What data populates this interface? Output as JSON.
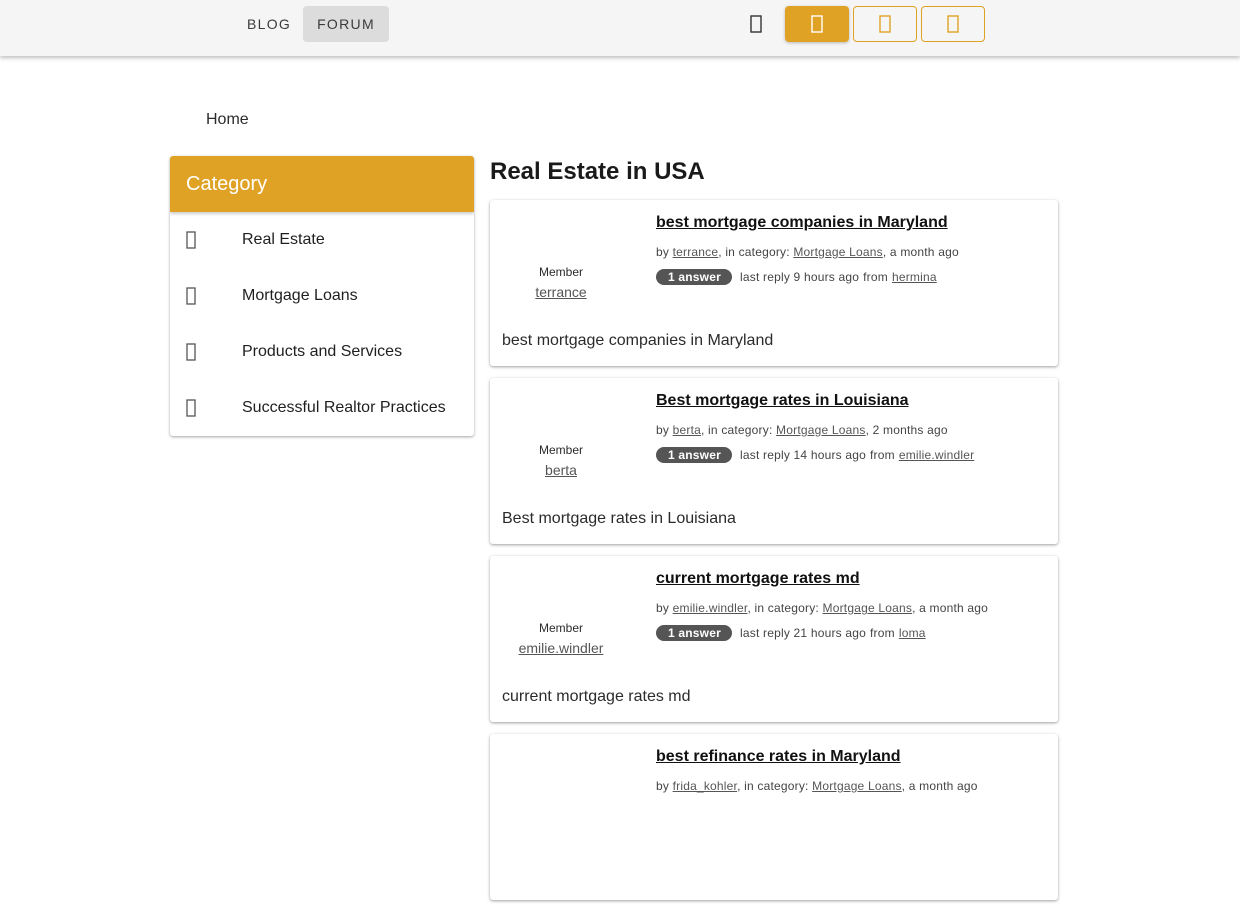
{
  "nav": {
    "blog_label": "BLOG",
    "forum_label": "FORUM",
    "icons": [
      "search-icon",
      "primary-action-icon",
      "outline-action-icon",
      "outline-action-icon"
    ],
    "accent_color": "#e0a224"
  },
  "breadcrumb": {
    "home_label": "Home"
  },
  "sidebar": {
    "header": "Category",
    "items": [
      {
        "label": "Real Estate",
        "icon": "category-icon"
      },
      {
        "label": "Mortgage Loans",
        "icon": "category-icon"
      },
      {
        "label": "Products and Services",
        "icon": "category-icon"
      },
      {
        "label": "Successful Realtor Practices",
        "icon": "category-icon"
      }
    ]
  },
  "main": {
    "title": "Real Estate in USA",
    "posts": [
      {
        "author_role": "Member",
        "author": "terrance",
        "title": "best mortgage companies in Maryland",
        "by_prefix": "by",
        "category_prefix": ", in category:",
        "category": "Mortgage Loans",
        "posted": ", a month ago",
        "answers": "1 answer",
        "last_reply": "last reply 9 hours ago",
        "from_label": "from",
        "reply_user": "hermina",
        "excerpt": "best mortgage companies in Maryland"
      },
      {
        "author_role": "Member",
        "author": "berta",
        "title": "Best mortgage rates in Louisiana",
        "by_prefix": "by",
        "category_prefix": ", in category:",
        "category": "Mortgage Loans",
        "posted": ", 2 months ago",
        "answers": "1 answer",
        "last_reply": "last reply 14 hours ago",
        "from_label": "from",
        "reply_user": "emilie.windler",
        "excerpt": "Best mortgage rates in Louisiana"
      },
      {
        "author_role": "Member",
        "author": "emilie.windler",
        "title": "current mortgage rates md",
        "by_prefix": "by",
        "category_prefix": ", in category:",
        "category": "Mortgage Loans",
        "posted": ", a month ago",
        "answers": "1 answer",
        "last_reply": "last reply 21 hours ago",
        "from_label": "from",
        "reply_user": "loma",
        "excerpt": "current mortgage rates md"
      },
      {
        "author_role": "",
        "author": "",
        "title": "best refinance rates in Maryland",
        "by_prefix": "by",
        "category_prefix": ", in category:",
        "category": "Mortgage Loans",
        "posted": ", a month ago",
        "answers": "",
        "last_reply": "",
        "from_label": "",
        "reply_user": "",
        "excerpt": ""
      }
    ]
  }
}
